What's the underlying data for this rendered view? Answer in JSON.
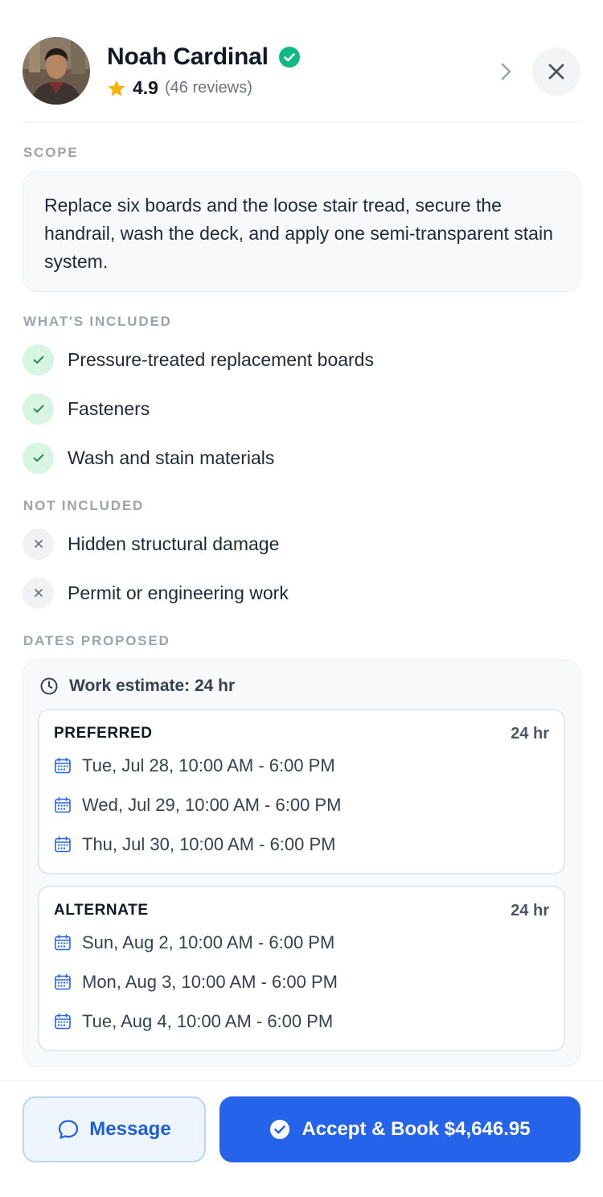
{
  "provider": {
    "name": "Noah Cardinal",
    "rating": "4.9",
    "reviews": "(46 reviews)"
  },
  "scope": {
    "label": "SCOPE",
    "text": "Replace six boards and the loose stair tread, secure the handrail, wash the deck, and apply one semi-transparent stain system."
  },
  "included": {
    "label": "WHAT'S INCLUDED",
    "items": [
      "Pressure-treated replacement boards",
      "Fasteners",
      "Wash and stain materials"
    ]
  },
  "not_included": {
    "label": "NOT INCLUDED",
    "items": [
      "Hidden structural damage",
      "Permit or engineering work"
    ]
  },
  "dates": {
    "label": "DATES PROPOSED",
    "estimate": "Work estimate: 24 hr",
    "preferred": {
      "title": "PREFERRED",
      "hours": "24 hr",
      "slots": [
        "Tue, Jul 28, 10:00 AM - 6:00 PM",
        "Wed, Jul 29, 10:00 AM - 6:00 PM",
        "Thu, Jul 30, 10:00 AM - 6:00 PM"
      ]
    },
    "alternate": {
      "title": "ALTERNATE",
      "hours": "24 hr",
      "slots": [
        "Sun, Aug 2, 10:00 AM - 6:00 PM",
        "Mon, Aug 3, 10:00 AM - 6:00 PM",
        "Tue, Aug 4, 10:00 AM - 6:00 PM"
      ]
    }
  },
  "actions": {
    "message": "Message",
    "accept": "Accept & Book $4,646.95"
  },
  "colors": {
    "accent": "#2563eb",
    "verified": "#10b981",
    "star": "#f5b400",
    "included_badge": "#d7f5e2"
  },
  "icons": [
    "verified-check-icon",
    "star-icon",
    "chevron-right-icon",
    "close-icon",
    "check-icon",
    "x-icon",
    "clock-icon",
    "calendar-icon",
    "chat-bubble-icon",
    "check-circle-icon"
  ]
}
